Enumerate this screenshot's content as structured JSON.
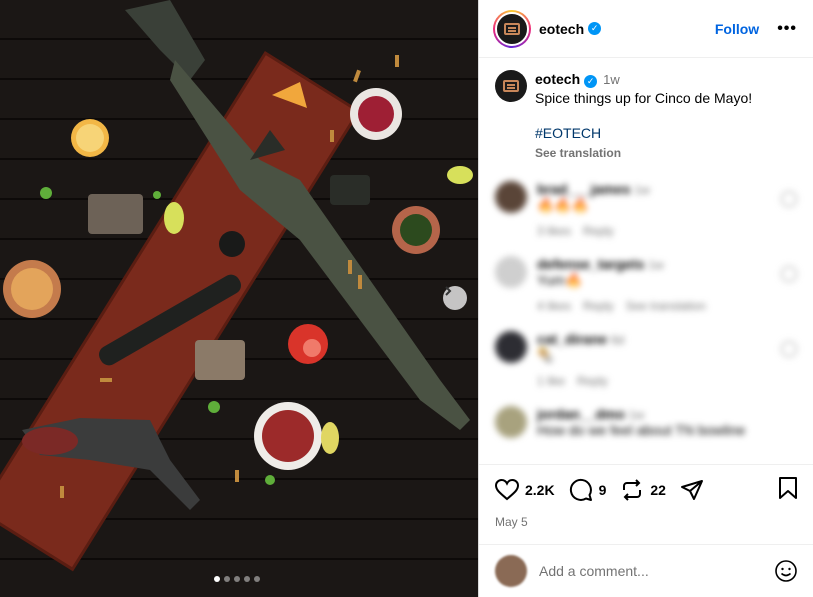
{
  "colors": {
    "accent": "#0064e0",
    "link": "#00376b",
    "verified": "#0095f6",
    "muted": "#737373"
  },
  "post": {
    "username": "eotech",
    "follow_label": "Follow",
    "more_label": "•••",
    "caption_user": "eotech",
    "caption_time": "1w",
    "caption_text": "Spice things up for Cinco de Mayo!",
    "hashtag": "#EOTECH",
    "see_translation": "See translation"
  },
  "comments": [
    {
      "user": "brad___james",
      "time": "1w",
      "text": "🔥🔥🔥",
      "likes": "3 likes",
      "reply": "Reply",
      "extra": ""
    },
    {
      "user": "defense_targets",
      "time": "1w",
      "text": "Yum🔥",
      "likes": "4 likes",
      "reply": "Reply",
      "extra": "See translation"
    },
    {
      "user": "cat_dirane",
      "time": "6d",
      "text": "🌯",
      "likes": "1 like",
      "reply": "Reply",
      "extra": ""
    },
    {
      "user": "jordan__dmo",
      "time": "1w",
      "text": "How do we feel about TN bowline",
      "likes": "",
      "reply": "",
      "extra": ""
    }
  ],
  "actions": {
    "likes": "2.2K",
    "comments": "9",
    "reposts": "22",
    "date": "May 5"
  },
  "composer": {
    "placeholder": "Add a comment..."
  },
  "carousel": {
    "slides": 5,
    "current": 1
  }
}
